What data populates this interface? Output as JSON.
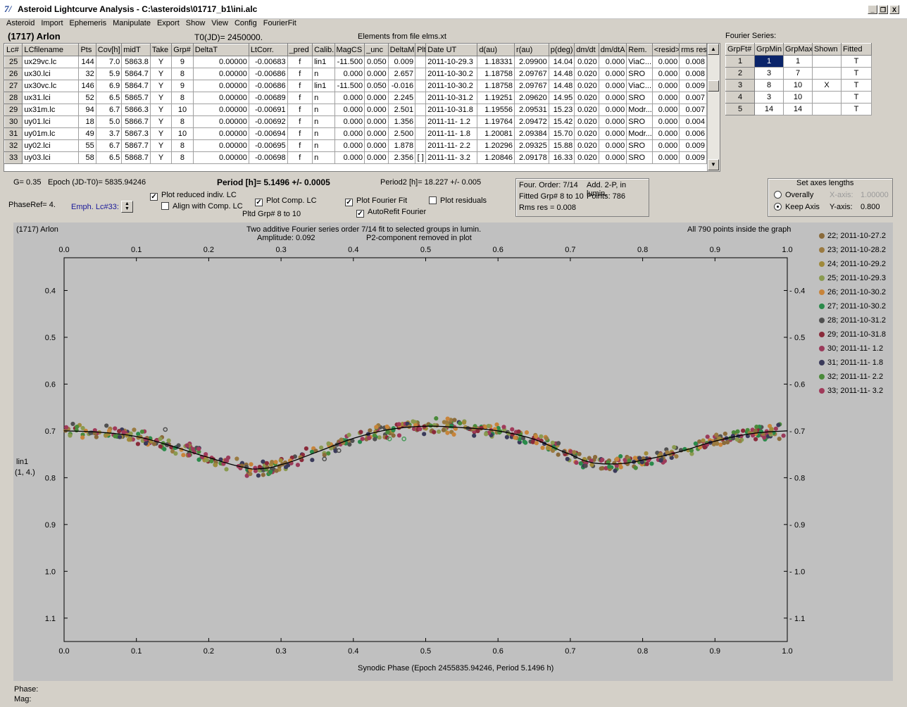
{
  "window": {
    "title": "Asteroid Lightcurve Analysis - C:\\asteroids\\01717_b1\\ini.alc",
    "min_glyph": "_",
    "restore_glyph": "❐",
    "close_glyph": "X"
  },
  "menu": [
    "Asteroid",
    "Import",
    "Ephemeris",
    "Manipulate",
    "Export",
    "Show",
    "View",
    "Config",
    "FourierFit"
  ],
  "header": {
    "object_name": "(1717) Arlon",
    "t0": "T0(JD)= 2450000.",
    "elements_source": "Elements from file elms.xt",
    "fourier_series_label": "Fourier Series:"
  },
  "lc_table": {
    "columns": [
      "Lc#",
      "LCfilename",
      "Pts",
      "Cov[h]",
      "midT",
      "Take",
      "Grp#",
      "DeltaT",
      "LtCorr.",
      "_pred",
      "Calib.",
      "MagCS",
      "_unc",
      "DeltaM",
      "Plt",
      "Date UT",
      "d(au)",
      "r(au)",
      "p(deg)",
      "dm/dt",
      "dm/dtA",
      "Rem.",
      "<resid>",
      "rms res"
    ],
    "rows": [
      [
        "25",
        "ux29vc.lc",
        "144",
        "7.0",
        "5863.8",
        "Y",
        "9",
        "0.00000",
        "-0.00683",
        "f",
        "lin1",
        "-11.500",
        "0.050",
        "0.009",
        "",
        "2011-10-29.3",
        "1.18331",
        "2.09900",
        "14.04",
        "0.020",
        "0.000",
        "ViaC...",
        "0.000",
        "0.008"
      ],
      [
        "26",
        "ux30.lci",
        "32",
        "5.9",
        "5864.7",
        "Y",
        "8",
        "0.00000",
        "-0.00686",
        "f",
        "n",
        "0.000",
        "0.000",
        "2.657",
        "",
        "2011-10-30.2",
        "1.18758",
        "2.09767",
        "14.48",
        "0.020",
        "0.000",
        "SRO",
        "0.000",
        "0.008"
      ],
      [
        "27",
        "ux30vc.lc",
        "146",
        "6.9",
        "5864.7",
        "Y",
        "9",
        "0.00000",
        "-0.00686",
        "f",
        "lin1",
        "-11.500",
        "0.050",
        "-0.016",
        "",
        "2011-10-30.2",
        "1.18758",
        "2.09767",
        "14.48",
        "0.020",
        "0.000",
        "ViaC...",
        "0.000",
        "0.009"
      ],
      [
        "28",
        "ux31.lci",
        "52",
        "6.5",
        "5865.7",
        "Y",
        "8",
        "0.00000",
        "-0.00689",
        "f",
        "n",
        "0.000",
        "0.000",
        "2.245",
        "",
        "2011-10-31.2",
        "1.19251",
        "2.09620",
        "14.95",
        "0.020",
        "0.000",
        "SRO",
        "0.000",
        "0.007"
      ],
      [
        "29",
        "ux31m.lc",
        "94",
        "6.7",
        "5866.3",
        "Y",
        "10",
        "0.00000",
        "-0.00691",
        "f",
        "n",
        "0.000",
        "0.000",
        "2.501",
        "",
        "2011-10-31.8",
        "1.19556",
        "2.09531",
        "15.23",
        "0.020",
        "0.000",
        "Modr...",
        "0.000",
        "0.007"
      ],
      [
        "30",
        "uy01.lci",
        "18",
        "5.0",
        "5866.7",
        "Y",
        "8",
        "0.00000",
        "-0.00692",
        "f",
        "n",
        "0.000",
        "0.000",
        "1.356",
        "",
        "2011-11- 1.2",
        "1.19764",
        "2.09472",
        "15.42",
        "0.020",
        "0.000",
        "SRO",
        "0.000",
        "0.004"
      ],
      [
        "31",
        "uy01m.lc",
        "49",
        "3.7",
        "5867.3",
        "Y",
        "10",
        "0.00000",
        "-0.00694",
        "f",
        "n",
        "0.000",
        "0.000",
        "2.500",
        "",
        "2011-11- 1.8",
        "1.20081",
        "2.09384",
        "15.70",
        "0.020",
        "0.000",
        "Modr...",
        "0.000",
        "0.006"
      ],
      [
        "32",
        "uy02.lci",
        "55",
        "6.7",
        "5867.7",
        "Y",
        "8",
        "0.00000",
        "-0.00695",
        "f",
        "n",
        "0.000",
        "0.000",
        "1.878",
        "",
        "2011-11- 2.2",
        "1.20296",
        "2.09325",
        "15.88",
        "0.020",
        "0.000",
        "SRO",
        "0.000",
        "0.009"
      ],
      [
        "33",
        "uy03.lci",
        "58",
        "6.5",
        "5868.7",
        "Y",
        "8",
        "0.00000",
        "-0.00698",
        "f",
        "n",
        "0.000",
        "0.000",
        "2.356",
        "[ ]",
        "2011-11- 3.2",
        "1.20846",
        "2.09178",
        "16.33",
        "0.020",
        "0.000",
        "SRO",
        "0.000",
        "0.009"
      ]
    ]
  },
  "fourier_table": {
    "columns": [
      "GrpFt#",
      "GrpMin",
      "GrpMax",
      "Shown",
      "Fitted"
    ],
    "rows": [
      [
        "1",
        "1",
        "1",
        "",
        "T"
      ],
      [
        "2",
        "3",
        "7",
        "",
        "T"
      ],
      [
        "3",
        "8",
        "10",
        "X",
        "T"
      ],
      [
        "4",
        "3",
        "10",
        "",
        "T"
      ],
      [
        "5",
        "14",
        "14",
        "",
        "T"
      ]
    ]
  },
  "status": {
    "g_value": "G= 0.35",
    "epoch": "Epoch (JD-T0)= 5835.94246",
    "period": "Period [h]= 5.1496 +/- 0.0005",
    "period2": "Period2 [h]= 18.227 +/- 0.005",
    "phase_ref": "PhaseRef= 4.",
    "emph": "Emph. Lc#33:",
    "pltd_grp": "Pltd Grp#  8  to   10",
    "chk_plot_reduced": "Plot reduced indiv. LC",
    "chk_align": "Align with Comp. LC",
    "chk_plot_comp": "Plot Comp. LC",
    "chk_plot_fourier": "Plot Fourier Fit",
    "chk_autorefit": "AutoRefit Fourier",
    "chk_residuals": "Plot residuals",
    "four_order": "Four. Order:  7/14",
    "add_2p": "Add. 2-P, in lumin.",
    "fitted_grp": "Fitted Grp# 8 to 10",
    "points": "Points: 786",
    "rms_res": "Rms res      = 0.008"
  },
  "axes_box": {
    "title": "Set axes lengths",
    "overally": "Overally",
    "keep_axis": "Keep Axis",
    "x_axis_label": "X-axis:",
    "x_axis_value": "1.00000",
    "y_axis_label": "Y-axis:",
    "y_axis_value": "0.800"
  },
  "bottom": {
    "phase_label": "Phase:",
    "mag_label": "Mag:"
  },
  "chart_data": {
    "type": "scatter",
    "object": "(1717) Arlon",
    "title": "Two additive Fourier series order 7/14 fit to selected groups in lumin.",
    "subtitle_left": "Amplitude: 0.092",
    "subtitle_right": "P2-component removed in plot",
    "note": "All 790 points inside the graph",
    "xlabel": "Synodic Phase (Epoch 2455835.94246, Period 5.1496 h)",
    "ylabel": "lin1",
    "ylabel2": "(1, 4.)",
    "xlim": [
      0.0,
      1.0
    ],
    "ylim": [
      0.62,
      1.15
    ],
    "y_inverted": true,
    "xticks": [
      "0.0",
      "0.1",
      "0.2",
      "0.3",
      "0.4",
      "0.5",
      "0.6",
      "0.7",
      "0.8",
      "0.9",
      "1.0"
    ],
    "yticks": [
      "0.4",
      "0.5",
      "0.6",
      "0.7",
      "0.8",
      "0.9",
      "1.0",
      "1.1"
    ],
    "fit_curve": [
      [
        0.0,
        0.7
      ],
      [
        0.05,
        0.703
      ],
      [
        0.1,
        0.712
      ],
      [
        0.15,
        0.733
      ],
      [
        0.2,
        0.757
      ],
      [
        0.25,
        0.778
      ],
      [
        0.27,
        0.781
      ],
      [
        0.3,
        0.772
      ],
      [
        0.35,
        0.745
      ],
      [
        0.4,
        0.716
      ],
      [
        0.45,
        0.697
      ],
      [
        0.5,
        0.69
      ],
      [
        0.55,
        0.693
      ],
      [
        0.6,
        0.7
      ],
      [
        0.65,
        0.718
      ],
      [
        0.7,
        0.75
      ],
      [
        0.73,
        0.768
      ],
      [
        0.77,
        0.77
      ],
      [
        0.8,
        0.762
      ],
      [
        0.85,
        0.745
      ],
      [
        0.9,
        0.722
      ],
      [
        0.95,
        0.706
      ],
      [
        1.0,
        0.7
      ]
    ],
    "series": [
      {
        "name": "22; 2011-10-27.2",
        "color": "#8a6a3a"
      },
      {
        "name": "23; 2011-10-28.2",
        "color": "#9a7a40"
      },
      {
        "name": "24; 2011-10-29.2",
        "color": "#a08a3a"
      },
      {
        "name": "25; 2011-10-29.3",
        "color": "#8a9a50"
      },
      {
        "name": "26; 2011-10-30.2",
        "color": "#c8843a"
      },
      {
        "name": "27; 2011-10-30.2",
        "color": "#2a8a4a"
      },
      {
        "name": "28; 2011-10-31.2",
        "color": "#505050"
      },
      {
        "name": "29; 2011-10-31.8",
        "color": "#8a2a3a"
      },
      {
        "name": "30; 2011-11- 1.2",
        "color": "#9a3a5a"
      },
      {
        "name": "31; 2011-11- 1.8",
        "color": "#3a3a5a"
      },
      {
        "name": "32; 2011-11- 2.2",
        "color": "#4a8a3a"
      },
      {
        "name": "33; 2011-11- 3.2",
        "color": "#a03a5a"
      }
    ]
  }
}
